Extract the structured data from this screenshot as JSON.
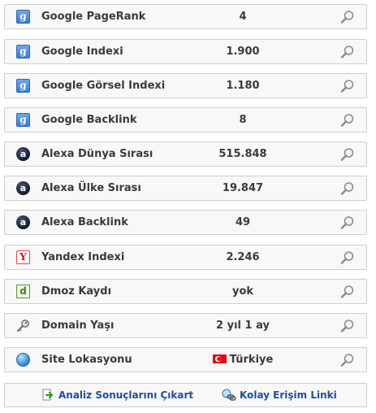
{
  "rows": [
    {
      "label": "Google PageRank",
      "value": "4",
      "icon": "google-icon",
      "icon_text": "g"
    },
    {
      "label": "Google Indexi",
      "value": "1.900",
      "icon": "google-icon",
      "icon_text": "g"
    },
    {
      "label": "Google Görsel Indexi",
      "value": "1.180",
      "icon": "google-icon",
      "icon_text": "g"
    },
    {
      "label": "Google Backlink",
      "value": "8",
      "icon": "google-icon",
      "icon_text": "g"
    },
    {
      "label": "Alexa Dünya Sırası",
      "value": "515.848",
      "icon": "alexa-icon",
      "icon_text": "a"
    },
    {
      "label": "Alexa Ülke Sırası",
      "value": "19.847",
      "icon": "alexa-icon",
      "icon_text": "a"
    },
    {
      "label": "Alexa Backlink",
      "value": "49",
      "icon": "alexa-icon",
      "icon_text": "a"
    },
    {
      "label": "Yandex Indexi",
      "value": "2.246",
      "icon": "yandex-icon",
      "icon_text": "Y"
    },
    {
      "label": "Dmoz Kaydı",
      "value": "yok",
      "icon": "dmoz-icon",
      "icon_text": "d"
    },
    {
      "label": "Domain Yaşı",
      "value": "2 yıl 1 ay",
      "icon": "key-icon",
      "icon_text": ""
    },
    {
      "label": "Site Lokasyonu",
      "value": "Türkiye",
      "icon": "globe-icon",
      "icon_text": "",
      "flag": "turkey-flag-icon"
    }
  ],
  "footer": {
    "export_label": "Analiz Sonuçlarını Çıkart",
    "export_icon": "arrow-export-icon",
    "link_label": "Kolay Erişim Linki",
    "link_icon": "chain-link-icon"
  },
  "colors": {
    "row_background": "#f8f8f8",
    "row_border": "#cfcfcf",
    "text": "#3a3a3a",
    "link": "#1f4f9a"
  }
}
